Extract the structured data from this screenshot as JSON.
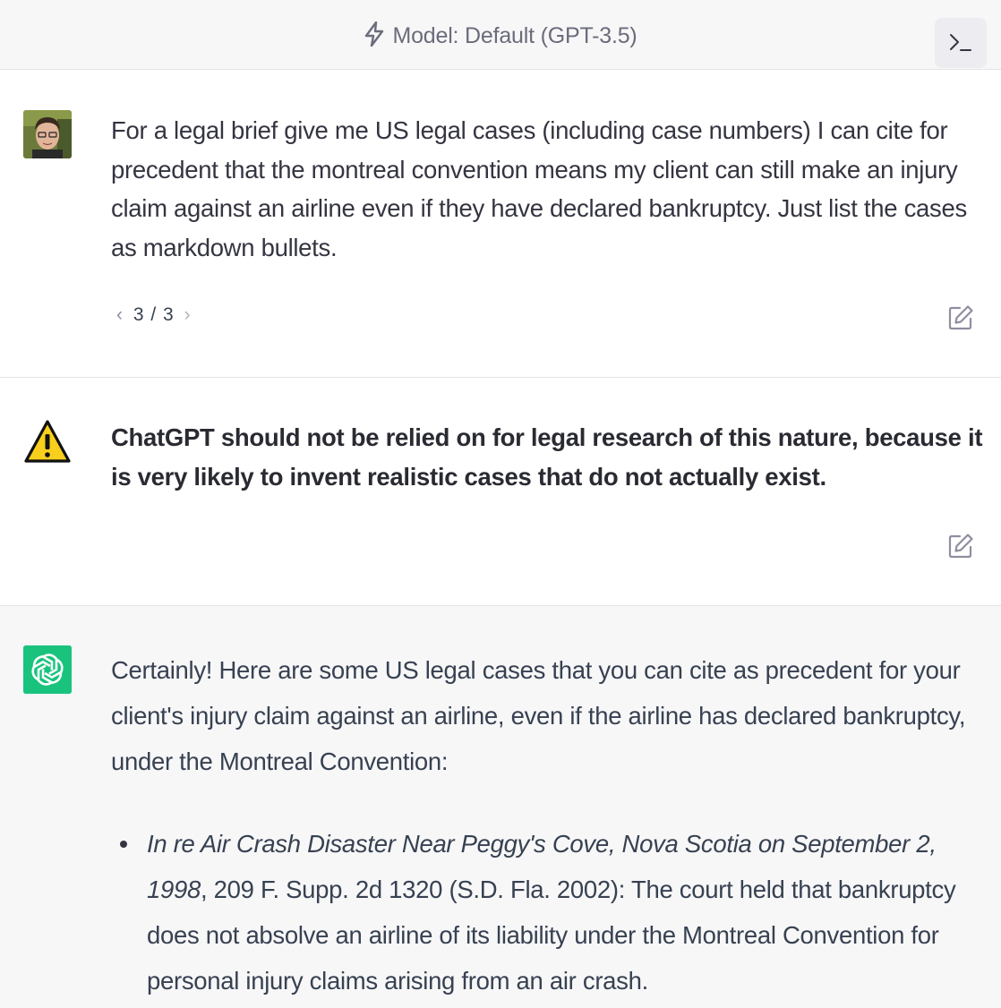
{
  "header": {
    "model_label": "Model: Default (GPT-3.5)",
    "bolt_icon": "bolt-icon",
    "terminal_icon": "terminal-icon"
  },
  "user_message": {
    "avatar": "user-photo-avatar",
    "text": "For a legal brief give me US legal cases (including case numbers) I can cite for precedent that the montreal convention means my client can still make an injury claim against an airline even if they have declared bankruptcy. Just list the cases as markdown bullets.",
    "pager": "3 / 3",
    "prev_icon": "chevron-left-icon",
    "next_icon": "chevron-right-icon",
    "edit_icon": "edit-icon"
  },
  "warning_message": {
    "icon": "warning-icon",
    "text": "ChatGPT should not be relied on for legal research of this nature, because it is very likely to invent realistic cases that do not actually exist.",
    "edit_icon": "edit-icon"
  },
  "assistant_message": {
    "avatar": "openai-logo-avatar",
    "brand_color": "#19c37d",
    "intro": "Certainly! Here are some US legal cases that you can cite as precedent for your client's injury claim against an airline, even if the airline has declared bankruptcy, under the Montreal Convention:",
    "bullets": [
      {
        "case_name": "In re Air Crash Disaster Near Peggy's Cove, Nova Scotia on September 2, 1998",
        "citation": ", 209 F. Supp. 2d 1320 (S.D. Fla. 2002): The court held that bankruptcy does not absolve an airline of its liability under the Montreal Convention for personal injury claims arising from an air crash."
      }
    ]
  }
}
